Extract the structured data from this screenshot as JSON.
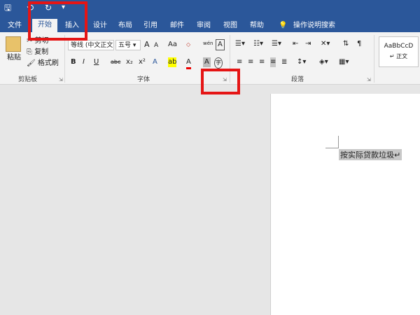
{
  "quick_access": {
    "save_icon": "floppy-icon",
    "undo_icon": "undo-icon",
    "redo_icon": "redo-icon",
    "customize_icon": "dropdown-icon",
    "undo_glyph": "⟲",
    "redo_glyph": "↻",
    "save_glyph": "🖫",
    "dropdown_glyph": "▾"
  },
  "tabs": [
    "文件",
    "开始",
    "插入",
    "设计",
    "布局",
    "引用",
    "邮件",
    "审阅",
    "视图",
    "帮助"
  ],
  "active_tab": "开始",
  "tell_me": "操作说明搜索",
  "tell_me_icon": "lightbulb-icon",
  "clipboard": {
    "paste": "粘贴",
    "cut": "剪切",
    "copy": "复制",
    "format_painter": "格式刷",
    "label": "剪贴板"
  },
  "font": {
    "font_name": "等线 (中文正文",
    "font_size": "五号",
    "grow": "A",
    "shrink": "A",
    "change_case": "Aa",
    "phonetic": "wén",
    "char_border": "A",
    "bold": "B",
    "italic": "I",
    "underline": "U",
    "strikethrough": "abc",
    "subscript": "x₂",
    "superscript": "x²",
    "text_effects": "A",
    "highlight": "ab",
    "font_color": "A",
    "char_shading": "A",
    "enclose": "字",
    "label": "字体"
  },
  "paragraph": {
    "label": "段落"
  },
  "styles": {
    "sample": "AaBbCcD",
    "name": "↵ 正文"
  },
  "document": {
    "text": "按实际贷款垃圾↵"
  },
  "colors": {
    "brand": "#2b579a",
    "highlight_box": "#e51515"
  }
}
